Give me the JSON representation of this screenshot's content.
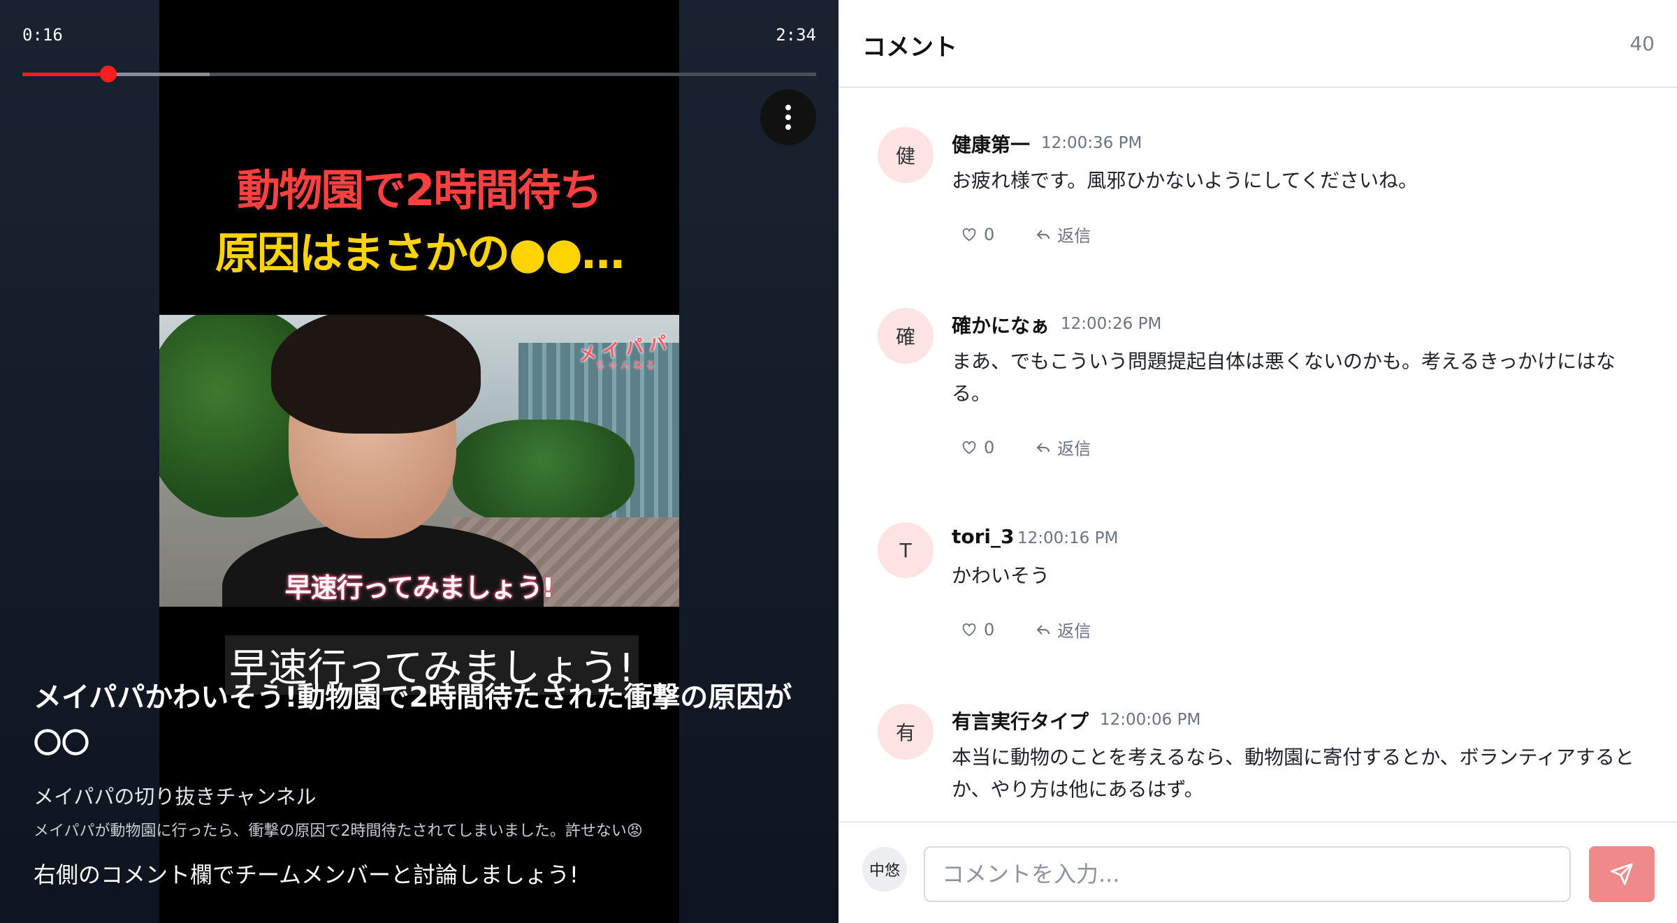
{
  "player": {
    "time_current": "0:16",
    "time_total": "2:34",
    "played_fraction": 0.108,
    "buffered_fraction": 0.236,
    "more_icon": "more-vertical-icon",
    "accent_color": "#ff1e1e"
  },
  "thumbnail": {
    "headline_line1": "動物園で2時間待ち",
    "headline_line2": "原因はまさかの●●…",
    "watermark": "メイパパ",
    "watermark_sub": "ちゃんねる",
    "subtitle": "早速行ってみましょう!",
    "caption": "早速行ってみましょう!"
  },
  "video": {
    "title": "メイパパかわいそう!動物園で2時間待たされた衝撃の原因が〇〇",
    "channel": "メイパパの切り抜きチャンネル",
    "description": "メイパパが動物園に行ったら、衝撃の原因で2時間待たされてしまいました。許せない😡",
    "prompt": "右側のコメント欄でチームメンバーと討論しましょう!"
  },
  "comments": {
    "title": "コメント",
    "count": "40",
    "items": [
      {
        "avatar": "健",
        "author": "健康第一",
        "time": "12:00:36 PM",
        "body": "お疲れ様です。風邪ひかないようにしてくださいね。",
        "likes": "0",
        "reply": "返信"
      },
      {
        "avatar": "確",
        "author": "確かになぁ",
        "time": "12:00:26 PM",
        "body": "まあ、でもこういう問題提起自体は悪くないのかも。考えるきっかけにはなる。",
        "likes": "0",
        "reply": "返信"
      },
      {
        "avatar": "T",
        "author": "tori_3",
        "time": "12:00:16 PM",
        "body": "かわいそう",
        "likes": "0",
        "reply": "返信"
      },
      {
        "avatar": "有",
        "author": "有言実行タイプ",
        "time": "12:00:06 PM",
        "body": "本当に動物のことを考えるなら、動物園に寄付するとか、ボランティアするとか、やり方は他にあるはず。",
        "likes": "0",
        "reply": "返信"
      }
    ]
  },
  "composer": {
    "my_avatar": "中悠",
    "placeholder": "コメントを入力...",
    "value": "",
    "send_icon": "send-icon",
    "send_color": "#f08a8a"
  }
}
